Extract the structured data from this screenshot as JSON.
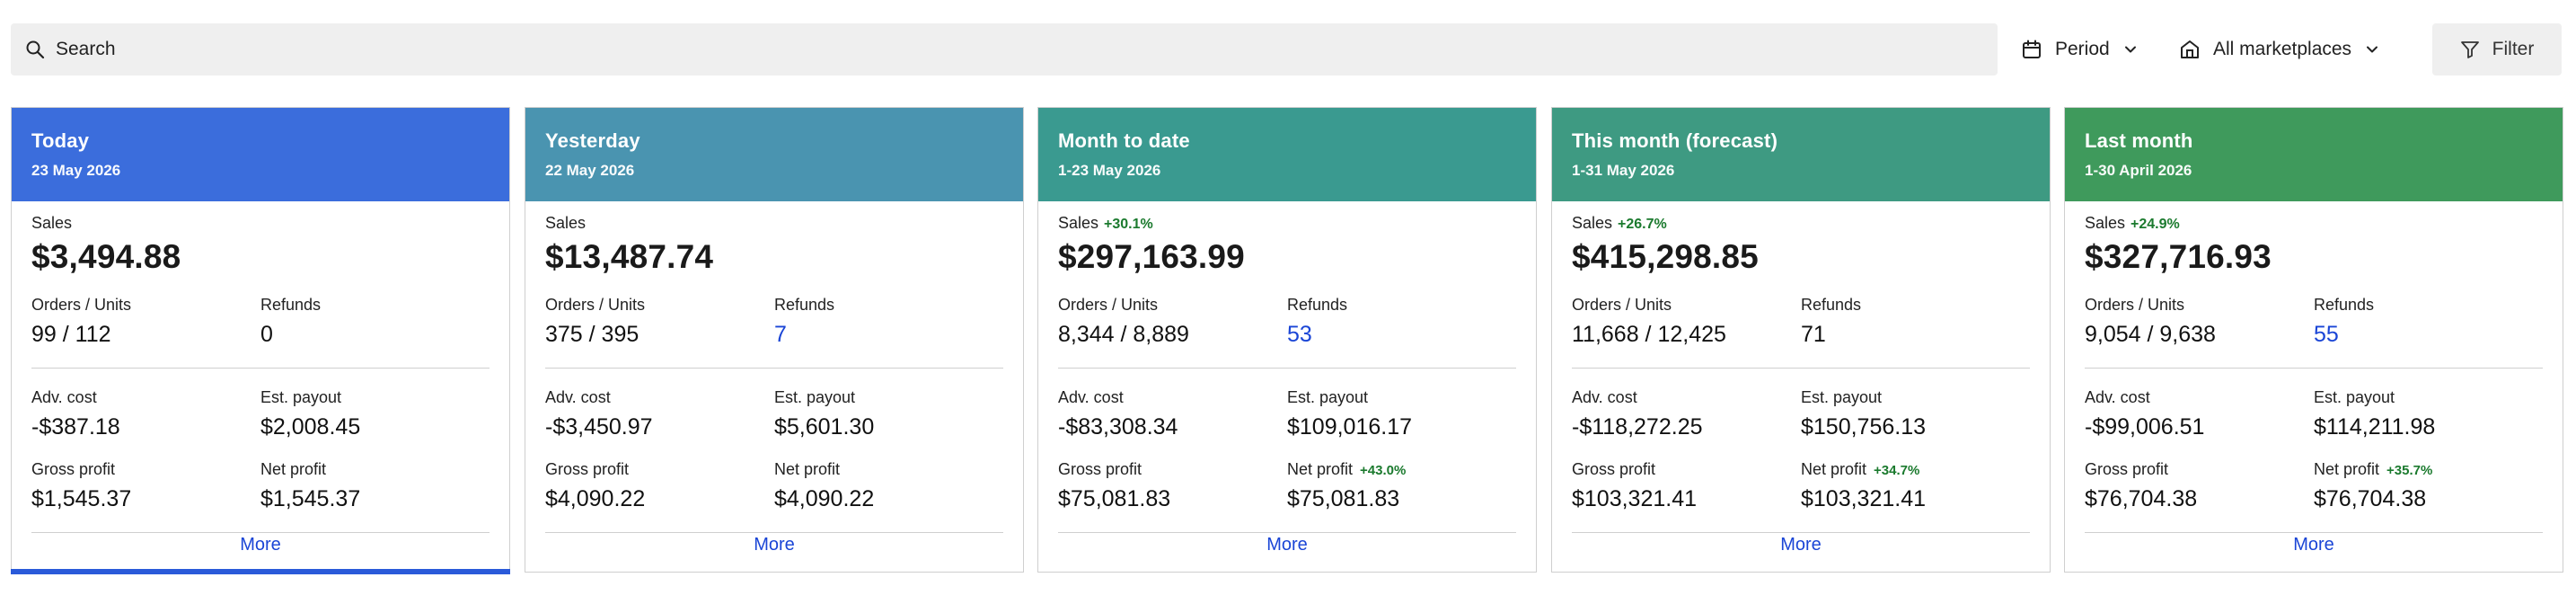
{
  "toolbar": {
    "search_placeholder": "Search",
    "period_label": "Period",
    "marketplace_label": "All marketplaces",
    "filter_label": "Filter"
  },
  "cards": [
    {
      "title": "Today",
      "date": "23 May 2026",
      "color": "#3b6ddc",
      "sales_label": "Sales",
      "sales_delta": "",
      "sales": "$3,494.88",
      "orders_label": "Orders / Units",
      "orders": "99 / 112",
      "refunds_label": "Refunds",
      "refunds": "0",
      "adv_label": "Adv. cost",
      "adv": "-$387.18",
      "payout_label": "Est. payout",
      "payout": "$2,008.45",
      "gross_label": "Gross profit",
      "gross": "$1,545.37",
      "net_label": "Net profit",
      "net_delta": "",
      "net": "$1,545.37",
      "more": "More"
    },
    {
      "title": "Yesterday",
      "date": "22 May 2026",
      "color": "#4a94b0",
      "sales_label": "Sales",
      "sales_delta": "",
      "sales": "$13,487.74",
      "orders_label": "Orders / Units",
      "orders": "375 / 395",
      "refunds_label": "Refunds",
      "refunds": "7",
      "adv_label": "Adv. cost",
      "adv": "-$3,450.97",
      "payout_label": "Est. payout",
      "payout": "$5,601.30",
      "gross_label": "Gross profit",
      "gross": "$4,090.22",
      "net_label": "Net profit",
      "net_delta": "",
      "net": "$4,090.22",
      "more": "More"
    },
    {
      "title": "Month to date",
      "date": "1-23 May 2026",
      "color": "#3a9a90",
      "sales_label": "Sales",
      "sales_delta": "+30.1%",
      "sales": "$297,163.99",
      "orders_label": "Orders / Units",
      "orders": "8,344 / 8,889",
      "refunds_label": "Refunds",
      "refunds": "53",
      "adv_label": "Adv. cost",
      "adv": "-$83,308.34",
      "payout_label": "Est. payout",
      "payout": "$109,016.17",
      "gross_label": "Gross profit",
      "gross": "$75,081.83",
      "net_label": "Net profit",
      "net_delta": "+43.0%",
      "net": "$75,081.83",
      "more": "More"
    },
    {
      "title": "This month (forecast)",
      "date": "1-31 May 2026",
      "color": "#3e9a82",
      "sales_label": "Sales",
      "sales_delta": "+26.7%",
      "sales": "$415,298.85",
      "orders_label": "Orders / Units",
      "orders": "11,668 / 12,425",
      "refunds_label": "Refunds",
      "refunds": "71",
      "adv_label": "Adv. cost",
      "adv": "-$118,272.25",
      "payout_label": "Est. payout",
      "payout": "$150,756.13",
      "gross_label": "Gross profit",
      "gross": "$103,321.41",
      "net_label": "Net profit",
      "net_delta": "+34.7%",
      "net": "$103,321.41",
      "more": "More"
    },
    {
      "title": "Last month",
      "date": "1-30 April 2026",
      "color": "#3f9a5c",
      "sales_label": "Sales",
      "sales_delta": "+24.9%",
      "sales": "$327,716.93",
      "orders_label": "Orders / Units",
      "orders": "9,054 / 9,638",
      "refunds_label": "Refunds",
      "refunds": "55",
      "adv_label": "Adv. cost",
      "adv": "-$99,006.51",
      "payout_label": "Est. payout",
      "payout": "$114,211.98",
      "gross_label": "Gross profit",
      "gross": "$76,704.38",
      "net_label": "Net profit",
      "net_delta": "+35.7%",
      "net": "$76,704.38",
      "more": "More"
    }
  ],
  "colors": {
    "link": "#1a45d6",
    "positive_delta": "#1b7a2e",
    "active_underline": "#2a5ad9"
  },
  "icons": {
    "search": "search-icon",
    "period": "calendar-icon",
    "marketplace": "store-icon",
    "filter": "filter-icon",
    "dropdown": "chevron-down-icon"
  }
}
